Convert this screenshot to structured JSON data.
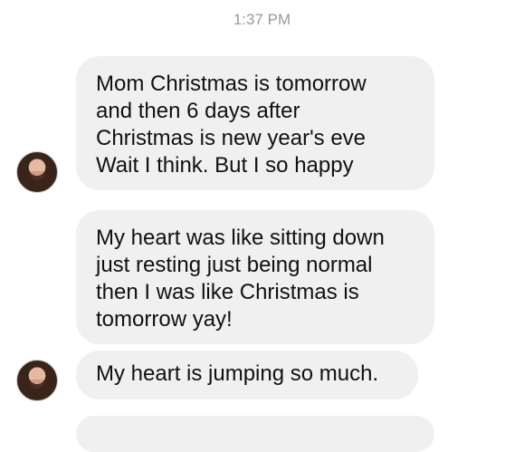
{
  "timestamp": "1:37 PM",
  "messages": [
    {
      "text": "Mom Christmas is tomorrow\nand then 6 days after\nChristmas is new year's eve\nWait I think. But I so happy"
    },
    {
      "text": "My heart was like sitting down\njust resting just being normal\nthen I was like Christmas is\ntomorrow yay!"
    },
    {
      "text": "My heart is jumping so much."
    }
  ]
}
